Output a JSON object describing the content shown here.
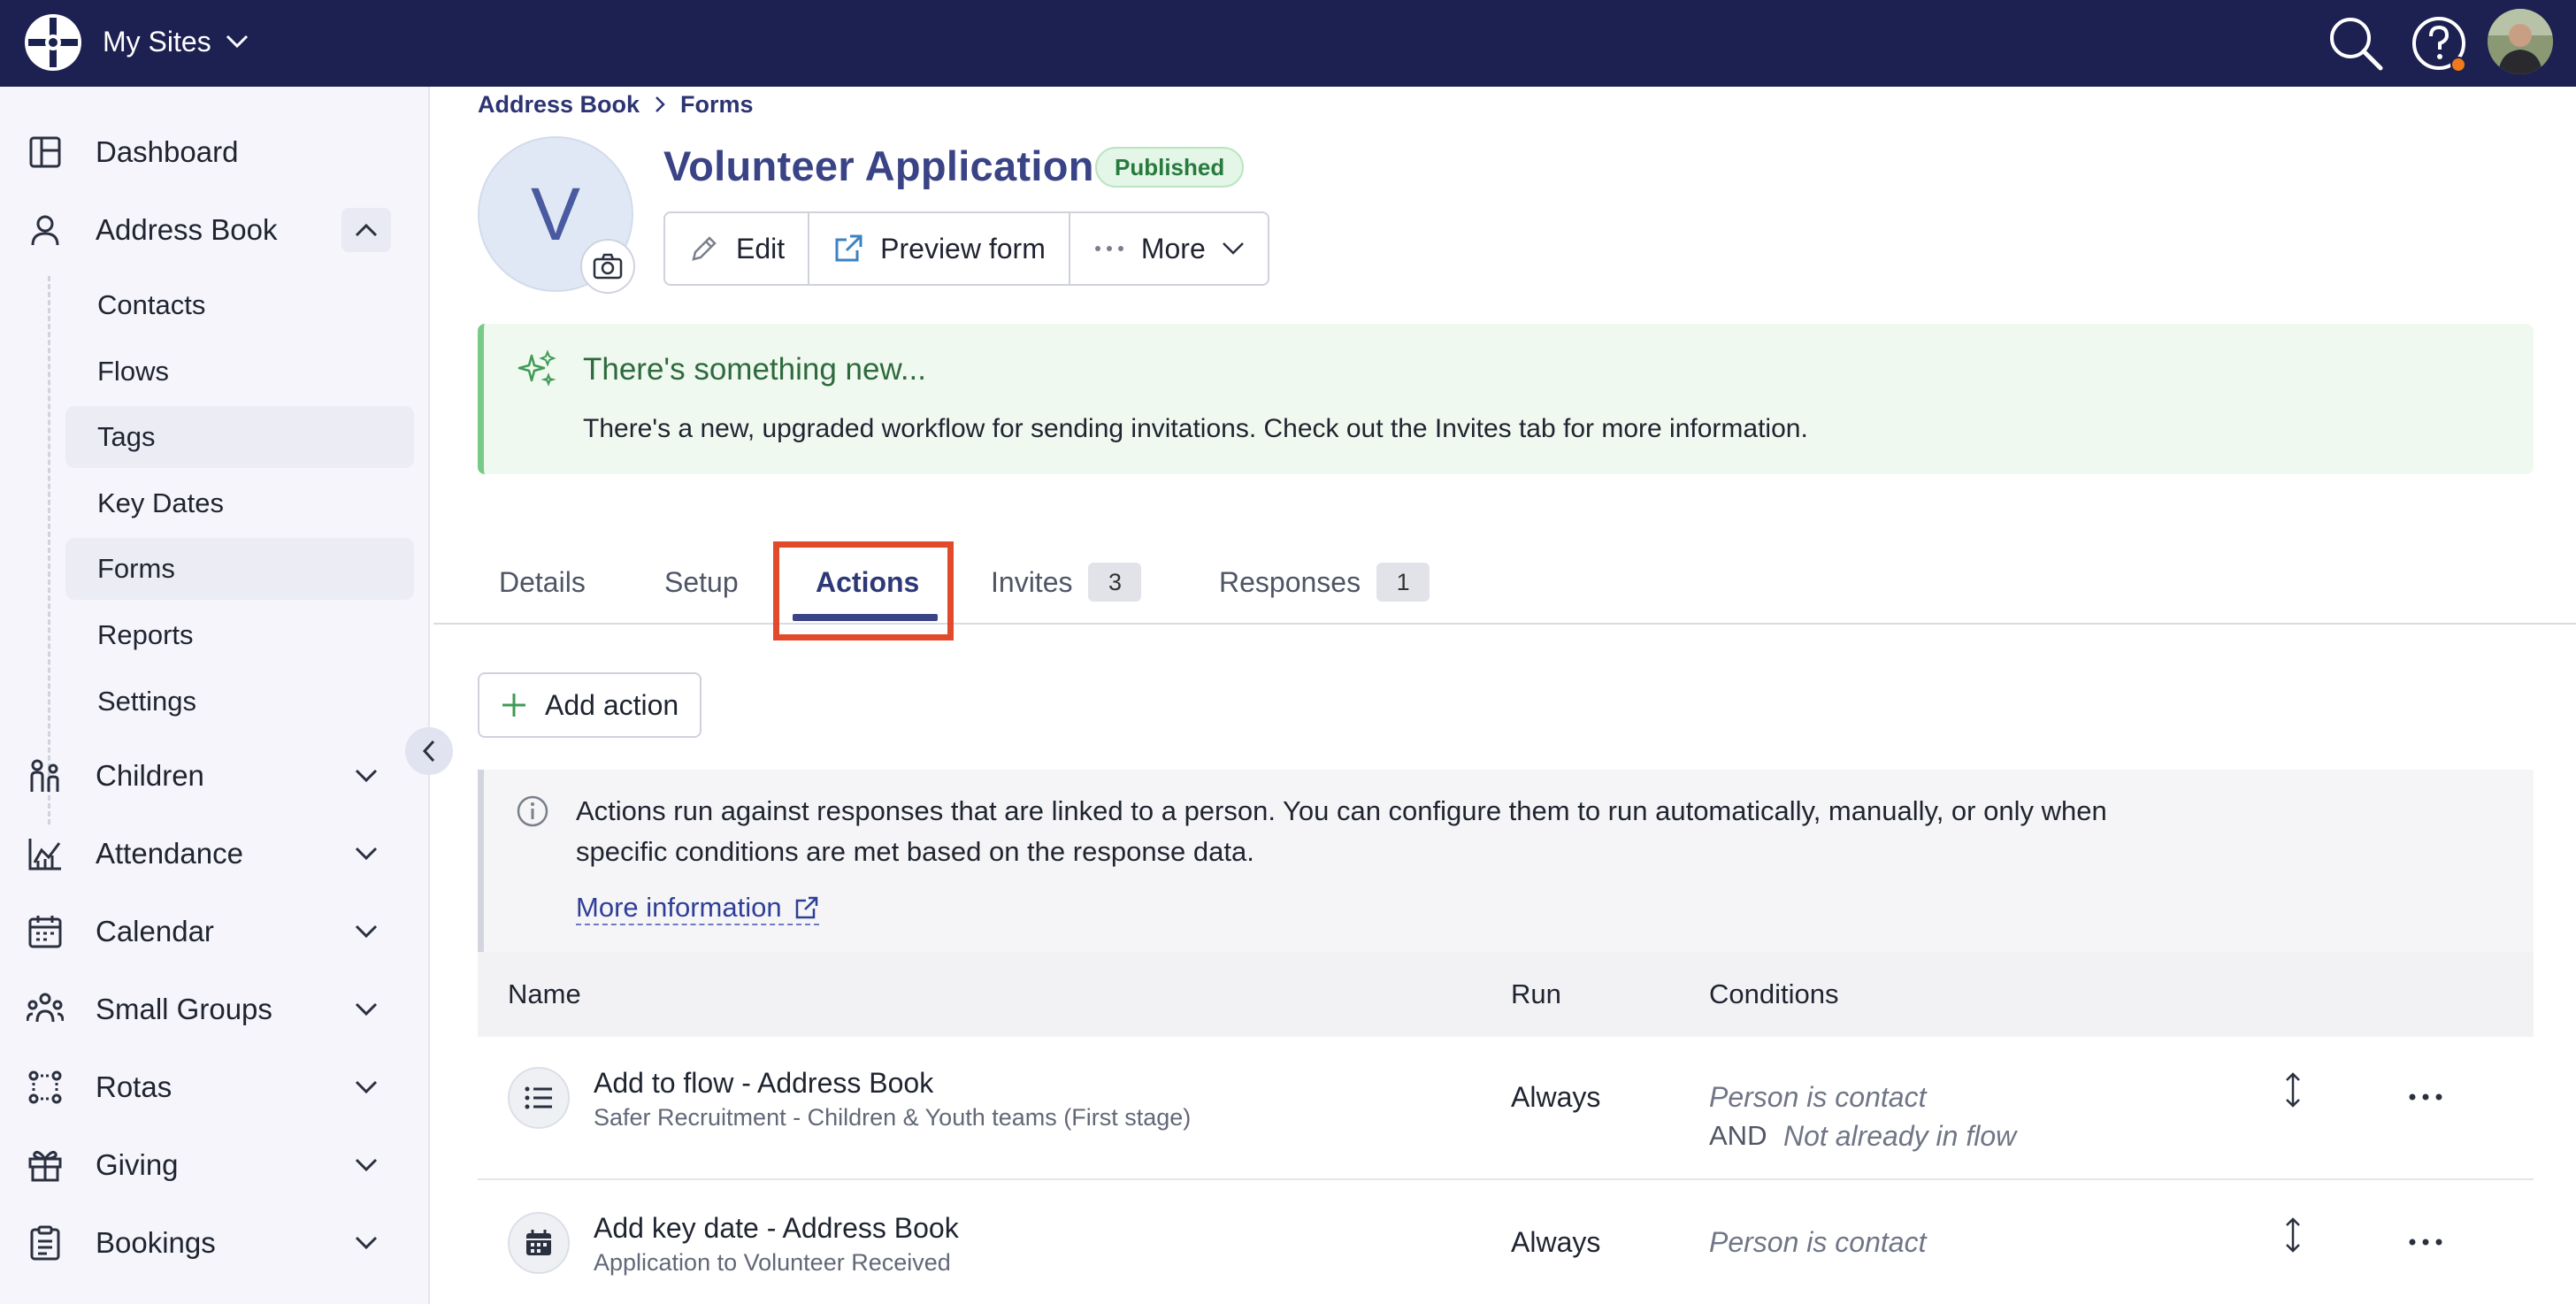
{
  "topbar": {
    "site_switch": "My Sites",
    "icons": [
      "search-icon",
      "help-icon",
      "user-avatar"
    ],
    "notification_color": "#ef7a1b"
  },
  "sidebar": {
    "items": [
      {
        "label": "Dashboard",
        "icon": "dashboard-icon"
      },
      {
        "label": "Address Book",
        "icon": "person-icon",
        "expanded": true
      },
      {
        "label": "Children",
        "icon": "children-icon"
      },
      {
        "label": "Attendance",
        "icon": "chart-icon"
      },
      {
        "label": "Calendar",
        "icon": "calendar-icon"
      },
      {
        "label": "Small Groups",
        "icon": "group-icon"
      },
      {
        "label": "Rotas",
        "icon": "rota-icon"
      },
      {
        "label": "Giving",
        "icon": "gift-icon"
      },
      {
        "label": "Bookings",
        "icon": "clipboard-icon"
      }
    ],
    "address_book_sub": [
      {
        "label": "Contacts"
      },
      {
        "label": "Flows"
      },
      {
        "label": "Tags"
      },
      {
        "label": "Key Dates"
      },
      {
        "label": "Forms"
      },
      {
        "label": "Reports"
      },
      {
        "label": "Settings"
      }
    ]
  },
  "breadcrumb": {
    "parent": "Address Book",
    "current": "Forms"
  },
  "form": {
    "initial": "V",
    "title": "Volunteer Application",
    "status": "Published"
  },
  "toolbar": {
    "edit": "Edit",
    "preview": "Preview form",
    "more": "More"
  },
  "notice": {
    "title": "There's something new...",
    "text": "There's a new, upgraded workflow for sending invitations. Check out the Invites tab for more information."
  },
  "tabs": [
    {
      "label": "Details"
    },
    {
      "label": "Setup"
    },
    {
      "label": "Actions",
      "active": true
    },
    {
      "label": "Invites",
      "count": "3"
    },
    {
      "label": "Responses",
      "count": "1"
    }
  ],
  "add_action": "Add action",
  "info": {
    "text": "Actions run against responses that are linked to a person. You can configure them to run automatically, manually, or only when specific conditions are met based on the response data.",
    "link": "More information"
  },
  "table": {
    "headers": {
      "name": "Name",
      "run": "Run",
      "conditions": "Conditions"
    },
    "rows": [
      {
        "icon": "list-icon",
        "title": "Add to flow - Address Book",
        "subtitle": "Safer Recruitment - Children & Youth teams (First stage)",
        "run": "Always",
        "condition1": "Person is contact",
        "and_label": "AND",
        "condition2": "Not already in flow"
      },
      {
        "icon": "calendar-icon",
        "title": "Add key date - Address Book",
        "subtitle": "Application to Volunteer Received",
        "run": "Always",
        "condition1": "Person is contact"
      }
    ]
  },
  "colors": {
    "topbar": "#1d2151",
    "accent": "#3a4385",
    "published_green": "#287a3d",
    "highlight_red": "#e14b2c"
  }
}
